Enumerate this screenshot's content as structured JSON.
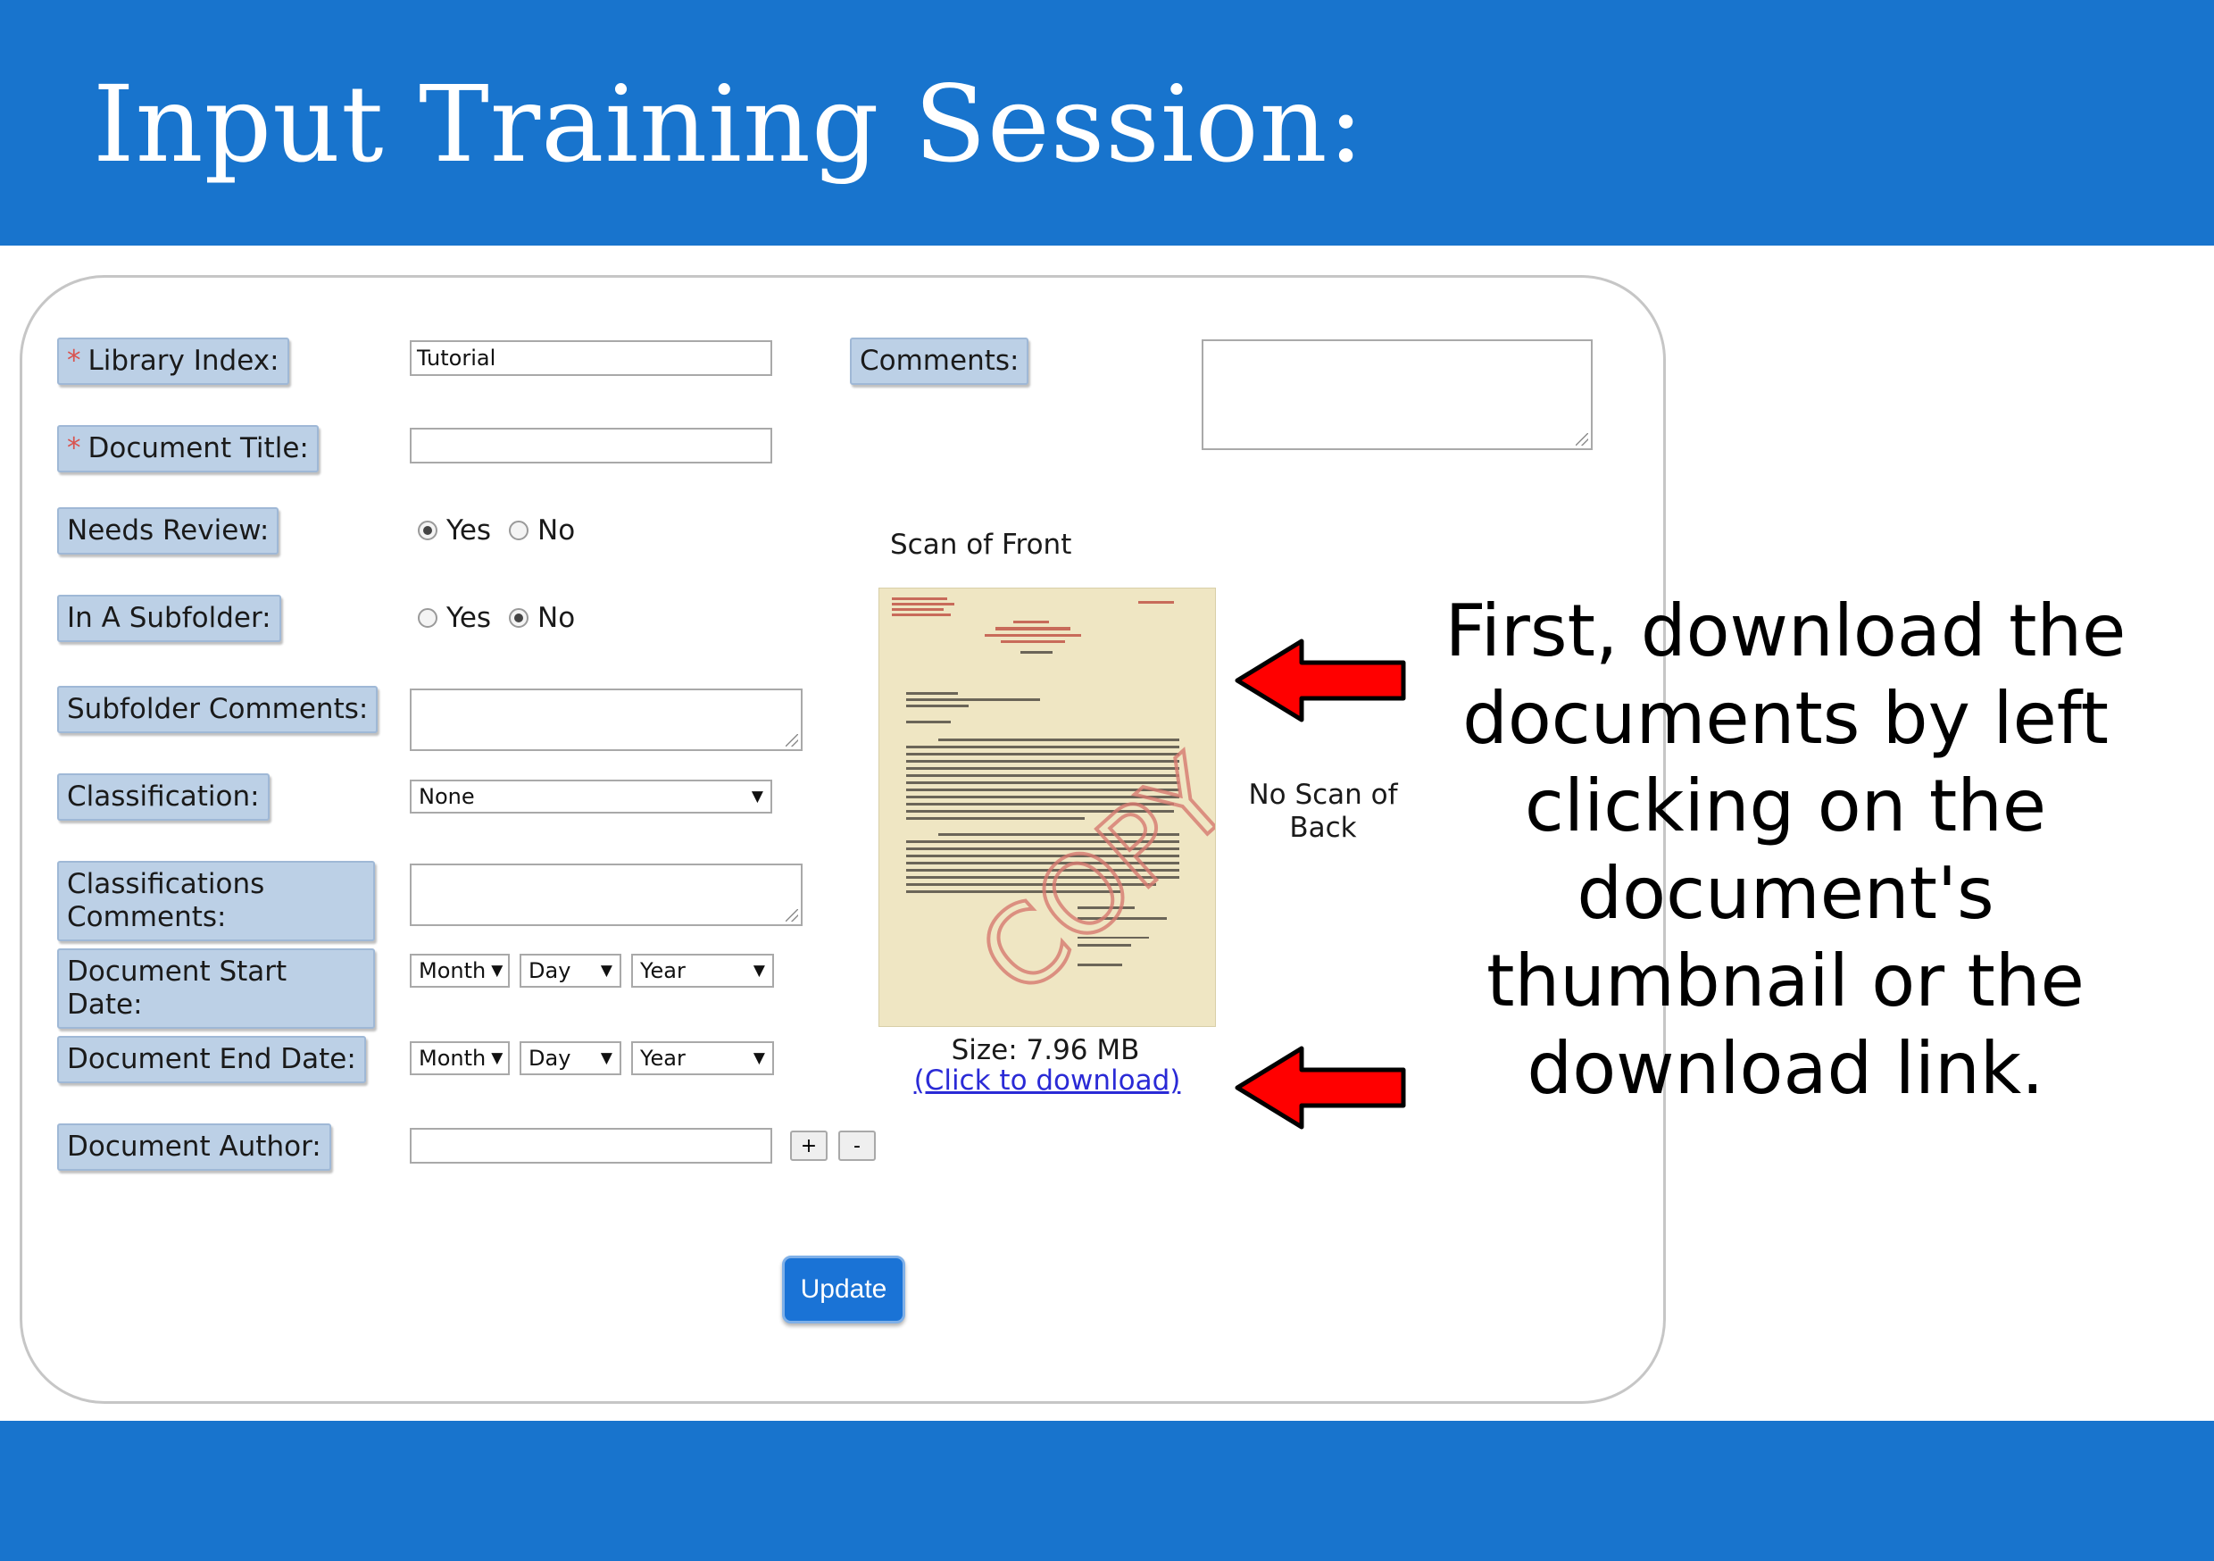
{
  "slide": {
    "title": "Input Training Session:",
    "instruction": "First, download the documents by left clicking on the document's thumbnail or the download link."
  },
  "form": {
    "required_marker": "*",
    "library_index": {
      "label": "Library Index:",
      "value": "Tutorial"
    },
    "document_title": {
      "label": "Document Title:",
      "value": ""
    },
    "needs_review": {
      "label": "Needs Review:",
      "yes": "Yes",
      "no": "No",
      "selected": "Yes"
    },
    "in_subfolder": {
      "label": "In A Subfolder:",
      "yes": "Yes",
      "no": "No",
      "selected": "No"
    },
    "subfolder_comments": {
      "label": "Subfolder Comments:",
      "value": ""
    },
    "classification": {
      "label": "Classification:",
      "value": "None"
    },
    "classifications_comments": {
      "label": "Classifications Comments:",
      "value": ""
    },
    "start_date": {
      "label": "Document Start Date:",
      "month": "Month",
      "day": "Day",
      "year": "Year"
    },
    "end_date": {
      "label": "Document End Date:",
      "month": "Month",
      "day": "Day",
      "year": "Year"
    },
    "author": {
      "label": "Document Author:",
      "value": "",
      "add": "+",
      "remove": "-"
    },
    "comments": {
      "label": "Comments:",
      "value": ""
    },
    "update_label": "Update"
  },
  "scans": {
    "front_label": "Scan of Front",
    "back_label": "No Scan of Back",
    "size_text": "Size: 7.96 MB",
    "download_text": "(Click to download)",
    "stamp_text": "COPY"
  },
  "colors": {
    "header_band": "#1874cd",
    "label_fill": "#bcd0e6",
    "required_marker": "#d9534f",
    "arrow": "#ff0000",
    "link": "#2a2ad6",
    "update_button": "#1a73d6"
  }
}
